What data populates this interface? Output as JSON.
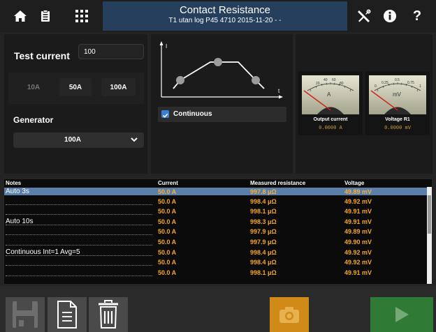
{
  "header": {
    "title": "Contact Resistance",
    "subtitle": "T1 utan log P45 4710 2015-11-20 - -",
    "icons": [
      "home-icon",
      "clipboard-icon",
      "grid-icon",
      "tools-icon",
      "info-icon",
      "help-icon"
    ],
    "help_label": "?"
  },
  "test_current": {
    "label": "Test current",
    "value": "100",
    "options": [
      "10A",
      "50A",
      "100A"
    ]
  },
  "generator": {
    "label": "Generator",
    "selected": "100A"
  },
  "graph": {
    "y_label": "I",
    "x_label": "t"
  },
  "continuous": {
    "label": "Continuous",
    "checked": true
  },
  "meters": [
    {
      "name": "Output current",
      "unit": "A",
      "reading": "0.0000 A",
      "scale": [
        "20",
        "40",
        "60",
        "80",
        "100"
      ]
    },
    {
      "name": "Voltage R1",
      "unit": "mV",
      "reading": "0.0000 mV",
      "scale": [
        "0",
        "0.25",
        "0.5",
        "0.75",
        "1"
      ]
    }
  ],
  "table": {
    "headers": {
      "notes": "Notes",
      "current": "Current",
      "resistance": "Measured resistance",
      "voltage": "Voltage"
    },
    "rows": [
      {
        "note": "Auto 3s",
        "current": "50.0 A",
        "resistance": "997.8 μΩ",
        "voltage": "49.89 mV"
      },
      {
        "note": "",
        "current": "50.0 A",
        "resistance": "998.4 μΩ",
        "voltage": "49.92 mV"
      },
      {
        "note": "",
        "current": "50.0 A",
        "resistance": "998.1 μΩ",
        "voltage": "49.91 mV"
      },
      {
        "note": "Auto 10s",
        "current": "50.0 A",
        "resistance": "998.3 μΩ",
        "voltage": "49.91 mV"
      },
      {
        "note": "",
        "current": "50.0 A",
        "resistance": "997.9 μΩ",
        "voltage": "49.89 mV"
      },
      {
        "note": "",
        "current": "50.0 A",
        "resistance": "997.9 μΩ",
        "voltage": "49.90 mV"
      },
      {
        "note": "Continuous Int=1 Avg=5",
        "current": "50.0 A",
        "resistance": "998.4 μΩ",
        "voltage": "49.92 mV"
      },
      {
        "note": "",
        "current": "50.0 A",
        "resistance": "998.4 μΩ",
        "voltage": "49.92 mV"
      },
      {
        "note": "",
        "current": "50.0 A",
        "resistance": "998.1 μΩ",
        "voltage": "49.91 mV"
      }
    ]
  },
  "toolbar": {
    "icons": [
      "save-icon",
      "document-icon",
      "trash-icon",
      "camera-icon",
      "play-icon"
    ],
    "colors": {
      "camera": "#d08a18",
      "play": "#2f7a35"
    }
  }
}
